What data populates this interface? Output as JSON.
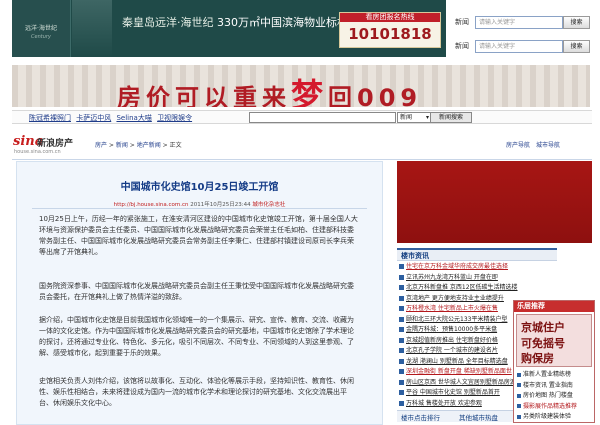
{
  "top_banner": {
    "logo_line1": "远洋·海世纪",
    "logo_line2": "Century",
    "slogan": "秦皇岛远洋·海世纪",
    "slogan_highlight": "330万㎡中国滨海物业标杆",
    "hotline_label": "看房团报名热线",
    "hotline_number": "10101818"
  },
  "mini_search": [
    {
      "label": "新闻",
      "placeholder": "请输入关键字",
      "button": "搜索"
    },
    {
      "label": "新闻",
      "placeholder": "请输入关键字",
      "button": "搜索"
    }
  ],
  "big_ad": {
    "text": "房价可以重来",
    "dream": "梦",
    "year": "回009"
  },
  "link_bar": {
    "links": [
      "陈冠希裸照门",
      "卡萨迈中风",
      "Selina大喵",
      "卫视限娱令"
    ],
    "select_value": "新闻",
    "search_button": "新闻搜索"
  },
  "sina": {
    "logo_mark": "sina",
    "logo_text": "新浪房产",
    "logo_url": "house.sina.com.cn"
  },
  "breadcrumb": [
    "房产",
    "新闻",
    "地产新闻",
    "正文"
  ],
  "right_nav": [
    "房产导航",
    "城市导航"
  ],
  "article": {
    "title": "中国城市化史馆10月25日竣工开馆",
    "meta_url": "http://bj.house.sina.com.cn",
    "meta_time": "2011年10月25日23:44",
    "meta_source": "城市化杂志社",
    "paragraphs": [
      "10月25日上午，历经一年的紧张施工，在淮安清河区建设的中国城市化史馆竣工开馆，第十届全国人大环境与资源保护委员会主任委员、中国国际城市化发展战略研究委员会荣誉主任毛如柏、住建部科技委常务副主任、中国国际城市化发展战略研究委员会常务副主任李秉仁、住建部村镇建设司原司长李兵荣等出席了开馆典礼。",
      "国务院资深参事、中国国际城市化发展战略研究委员会副主任王秉忱受中国国际城市化发展战略研究委员会委托，在开馆典礼上做了热情洋溢的致辞。",
      "据介绍，中国城市化史馆是目前我国城市化领域唯一的一个集展示、研究、宣传、教育、交流、收藏为一体的文化史馆。作为中国国际城市化发展战略研究委员会的研究基地，中国城市化史馆除了学术理论的探讨，还将通过专业化、特色化、多元化，吸引不同层次、不同专业、不同领域的人到这里参观、了解、感受城市化，起到重要于乐的效果。",
      "史馆相关负责人刘伟介绍，该馆将以故事化、互动化、体验化等展示手段，坚持知识性、教育性、休闲性、娱乐性相结合，未来将建设成为国内一流的城市化学术和理论探讨的研究基地、文化交流展出平台、休闲娱乐文化中心。"
    ]
  },
  "loushi_tab": "楼市资讯",
  "news_list": [
    {
      "text": "住宅在京万科金域华府成交房最佳选择",
      "red": true
    },
    {
      "text": "立讯苏州九龙湾万科蓝山 开盘在即",
      "red": false
    },
    {
      "text": "北京万科新盘推 京西12区低碳生活精选楼",
      "red": false
    },
    {
      "text": "京湾地产 更方便地支持业主业绩提升",
      "red": false
    },
    {
      "text": "万科橙水湾 住宅新品上市火爆在售",
      "red": true
    },
    {
      "text": "颐和北三环大院公元133平米精装户型",
      "red": false
    },
    {
      "text": "金隅万科城：预售10000多平米盘",
      "red": false
    },
    {
      "text": "京城超值新房推出 住宅新盘好价格",
      "red": false
    },
    {
      "text": "北京孔子学院 一个城市的建设名片",
      "red": false
    },
    {
      "text": "龙湖 滟澜山 别墅新品 全年目标精选盘",
      "red": false
    },
    {
      "text": "深圳金融街 新盘开盘 稀缺别墅新品面世",
      "red": true
    },
    {
      "text": "房山区京西 世华城人文宜居别墅新品房源",
      "red": false
    },
    {
      "text": "平谷 中国城市化史馆 别墅新品首开",
      "red": false
    },
    {
      "text": "万科城 售楼处开放 欢迎参观",
      "red": false
    }
  ],
  "bottom_tabs": [
    "楼市点击排行",
    "其他城市热盘"
  ],
  "float_panel": {
    "header": "乐居推荐",
    "img_words": [
      "京城住户",
      "可免摇号",
      "购保房"
    ],
    "items": [
      {
        "text": "准新人置业精练榜",
        "red": false
      },
      {
        "text": "楼市资讯 置业指南",
        "red": false
      },
      {
        "text": "房价地图 热门楼盘",
        "red": false
      },
      {
        "text": "摄影展作品精选推荐",
        "red": true
      },
      {
        "text": "另类阶级建装体验",
        "red": false
      }
    ]
  }
}
